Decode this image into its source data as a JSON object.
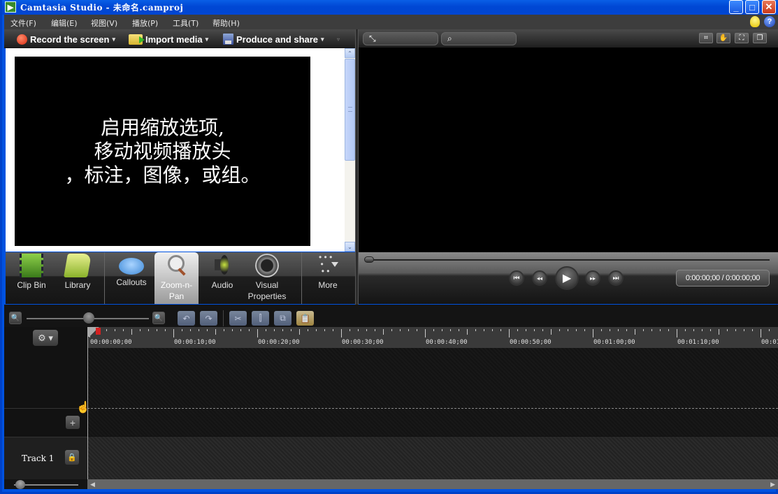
{
  "window": {
    "title": "Camtasia Studio - 未命名.camproj",
    "minimize": "_",
    "maximize": "□",
    "close": "✕"
  },
  "menubar": {
    "items": [
      {
        "label": "文件(F)"
      },
      {
        "label": "编辑(E)"
      },
      {
        "label": "视图(V)"
      },
      {
        "label": "播放(P)"
      },
      {
        "label": "工具(T)"
      },
      {
        "label": "帮助(H)"
      }
    ],
    "help_icon": "?"
  },
  "left_toolbar": {
    "record": "Record the screen",
    "import": "Import media",
    "produce": "Produce and share",
    "caret": "▾",
    "overflow": "▿"
  },
  "canvas": {
    "text": "启用缩放选项,\n移动视频播放头\n，标注，图像，或组。"
  },
  "scrollbar": {
    "up": "⌃",
    "down": "⌄"
  },
  "tabs": [
    {
      "label": "Clip Bin"
    },
    {
      "label": "Library"
    },
    {
      "label": "Callouts"
    },
    {
      "label": "Zoom-n-\nPan",
      "active": true
    },
    {
      "label": "Audio"
    },
    {
      "label": "Visual\nProperties"
    },
    {
      "label": "More"
    }
  ],
  "right_toolbar": {
    "fit_icon": "⤡",
    "search_icon": "⌕",
    "crop_icon": "⌗",
    "pan_icon": "✋",
    "fullscreen_icon": "⛶",
    "detach_icon": "❐"
  },
  "player": {
    "seek_position": 0,
    "prev": "⏮",
    "rewind": "◂◂",
    "play": "▶",
    "forward": "▸▸",
    "next": "⏭",
    "time": "0:00:00;00 / 0:00:00;00"
  },
  "timeline_toolbar": {
    "zoom_out": "🔍",
    "zoom_in": "🔍",
    "zoom_level": 0.5,
    "undo": "↶",
    "redo": "↷",
    "cut": "✂",
    "split": "⫿",
    "copy": "⧉",
    "paste": "📋"
  },
  "timeline": {
    "gear": "⚙ ▾",
    "ticks": [
      "00:00:00;00",
      "00:00:10;00",
      "00:00:20;00",
      "00:00:30;00",
      "00:00:40;00",
      "00:00:50;00",
      "00:01:00;00",
      "00:01:10;00",
      "00:01"
    ],
    "add_track": "+",
    "track_name": "Track 1",
    "lock": "🔒",
    "scroll_left": "◀",
    "scroll_right": "▶"
  }
}
